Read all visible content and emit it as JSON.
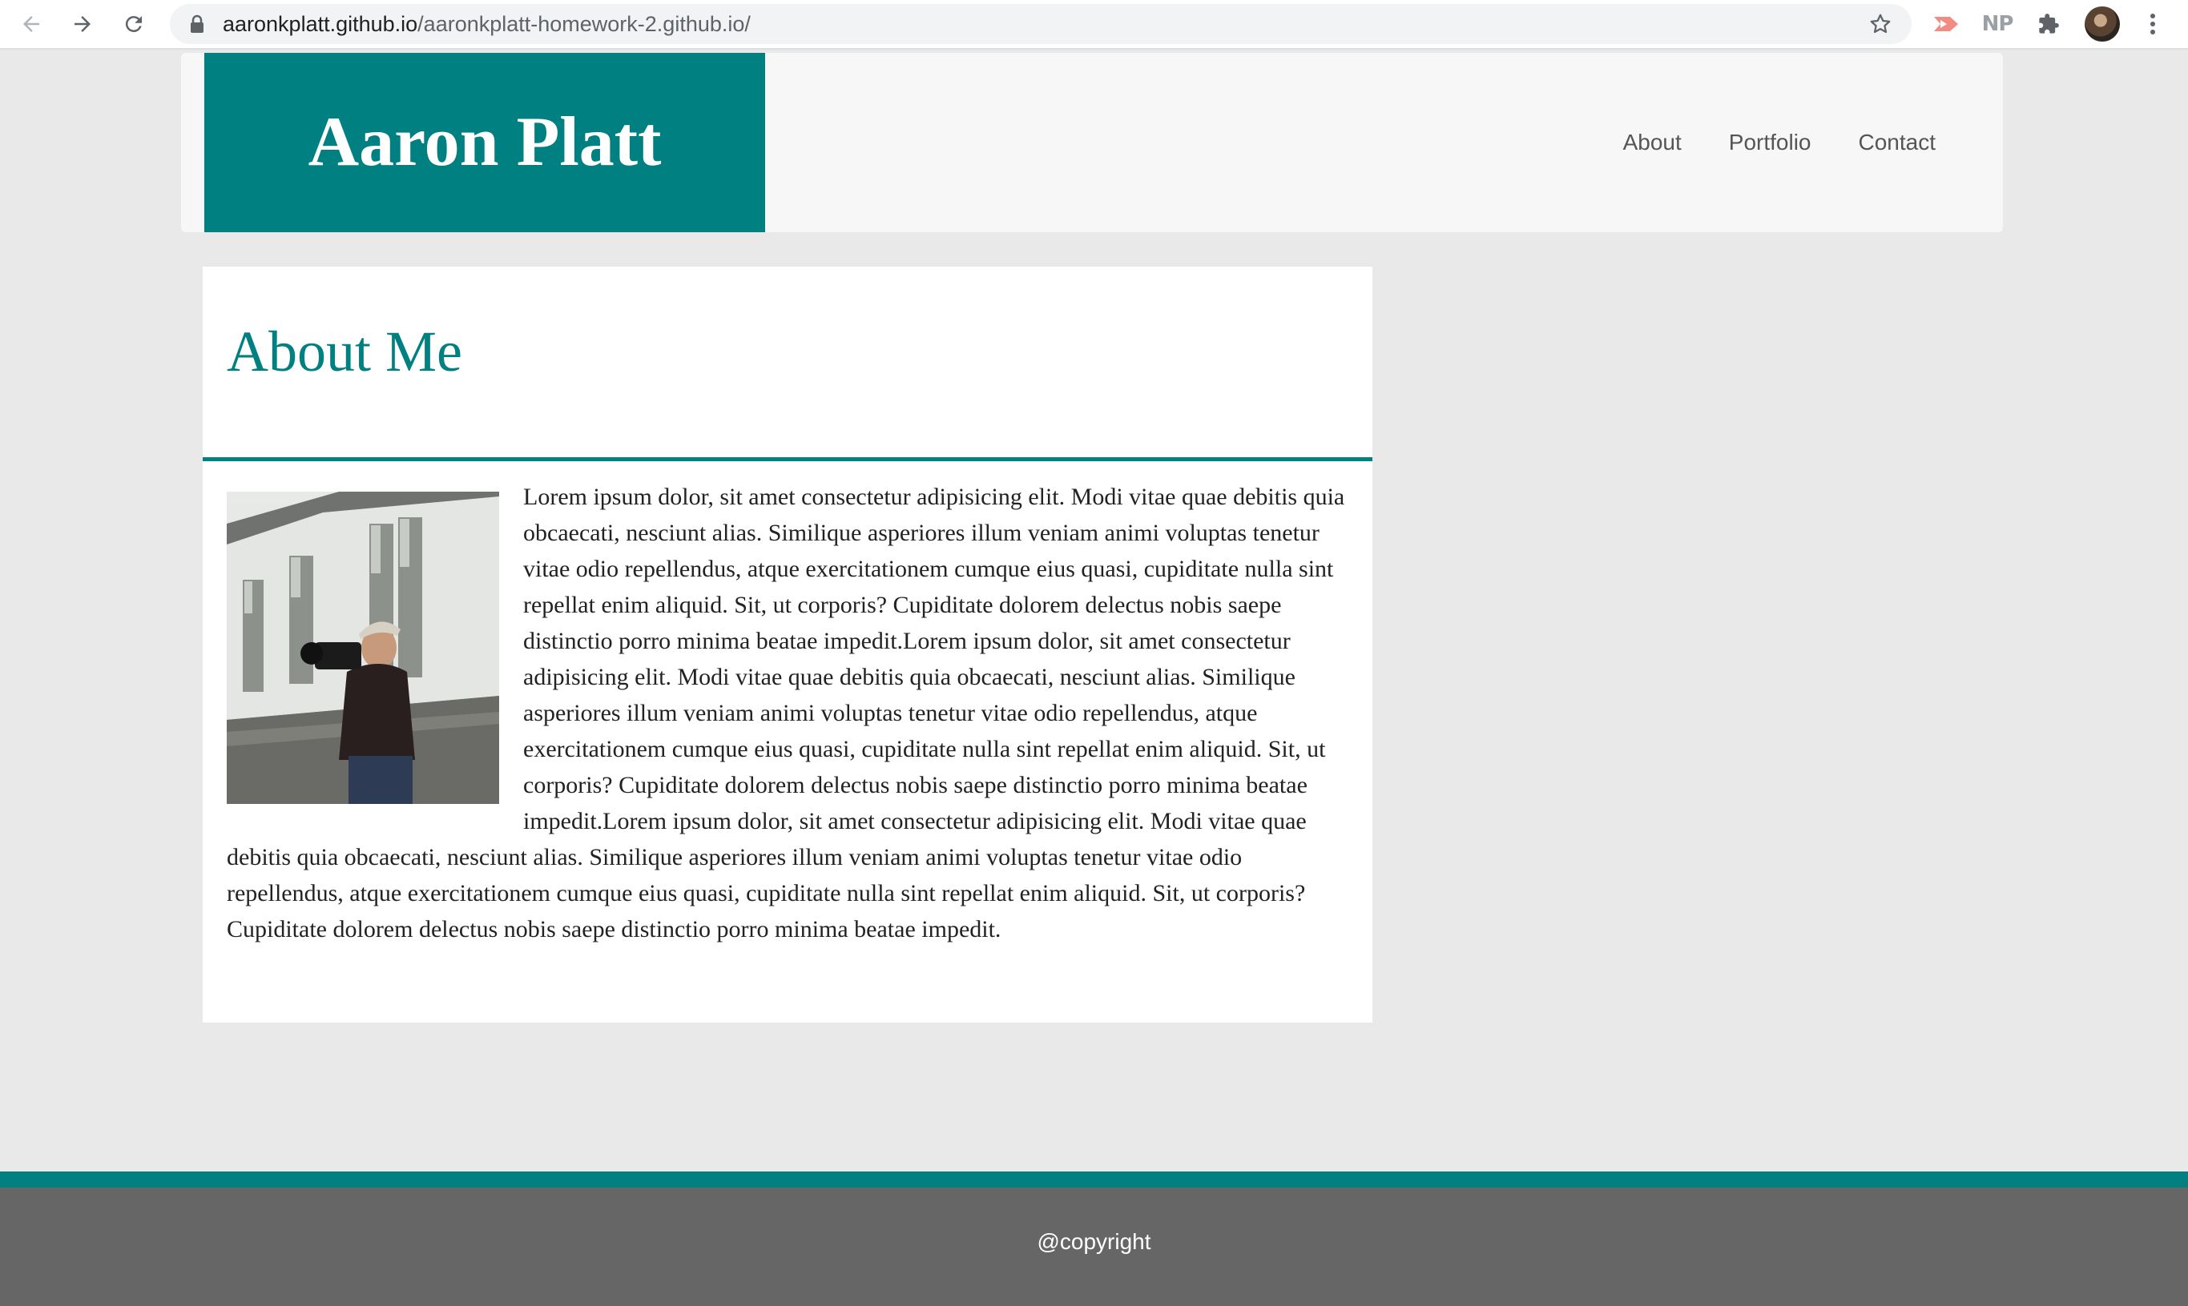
{
  "browser": {
    "url_host": "aaronkplatt.github.io",
    "url_path": "/aaronkplatt-homework-2.github.io/",
    "extension_np_label": "NP",
    "icons": [
      "back-arrow-icon",
      "forward-arrow-icon",
      "reload-icon",
      "lock-icon",
      "star-icon",
      "cast-extension-icon",
      "puzzle-extensions-icon",
      "kebab-menu-icon"
    ]
  },
  "header": {
    "title": "Aaron Platt",
    "nav": [
      "About",
      "Portfolio",
      "Contact"
    ],
    "brand_color": "#008080"
  },
  "about": {
    "heading": "About Me",
    "body": "Lorem ipsum dolor, sit amet consectetur adipisicing elit. Modi vitae quae debitis quia obcaecati, nesciunt alias. Similique asperiores illum veniam animi voluptas tenetur vitae odio repellendus, atque exercitationem cumque eius quasi, cupiditate nulla sint repellat enim aliquid. Sit, ut corporis? Cupiditate dolorem delectus nobis saepe distinctio porro minima beatae impedit.Lorem ipsum dolor, sit amet consectetur adipisicing elit. Modi vitae quae debitis quia obcaecati, nesciunt alias. Similique asperiores illum veniam animi voluptas tenetur vitae odio repellendus, atque exercitationem cumque eius quasi, cupiditate nulla sint repellat enim aliquid. Sit, ut corporis? Cupiditate dolorem delectus nobis saepe distinctio porro minima beatae impedit.Lorem ipsum dolor, sit amet consectetur adipisicing elit. Modi vitae quae debitis quia obcaecati, nesciunt alias. Similique asperiores illum veniam animi voluptas tenetur vitae odio repellendus, atque exercitationem cumque eius quasi, cupiditate nulla sint repellat enim aliquid. Sit, ut corporis? Cupiditate dolorem delectus nobis saepe distinctio porro minima beatae impedit."
  },
  "footer": {
    "copyright": "@copyright"
  }
}
